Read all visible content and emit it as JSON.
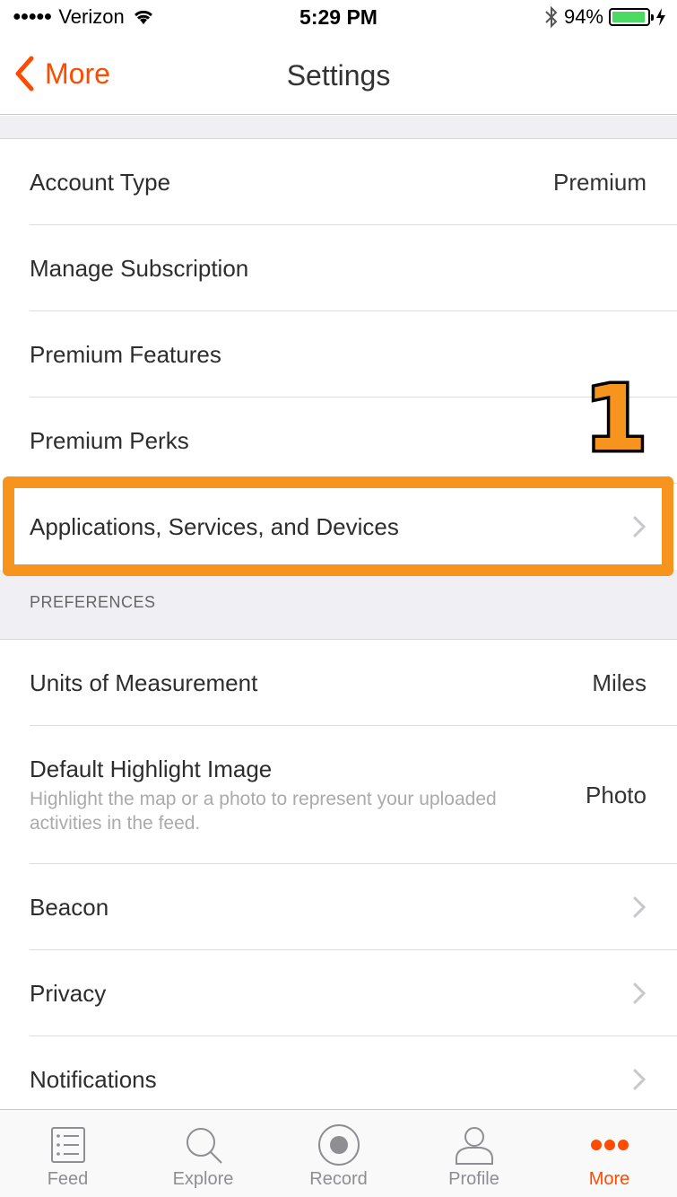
{
  "status_bar": {
    "signal": "●●●●●",
    "carrier": "Verizon",
    "time": "5:29 PM",
    "battery_percent": "94%"
  },
  "nav": {
    "back_label": "More",
    "title": "Settings"
  },
  "account_rows": [
    {
      "label": "Account Type",
      "value": "Premium"
    },
    {
      "label": "Manage Subscription",
      "value": ""
    },
    {
      "label": "Premium Features",
      "value": ""
    },
    {
      "label": "Premium Perks",
      "value": ""
    },
    {
      "label": "Applications, Services, and Devices",
      "value": ""
    }
  ],
  "annotation": {
    "number": "1"
  },
  "preferences": {
    "header": "PREFERENCES",
    "units": {
      "label": "Units of Measurement",
      "value": "Miles"
    },
    "highlight_image": {
      "label": "Default Highlight Image",
      "subtitle": "Highlight the map or a photo to represent your uploaded activities in the feed.",
      "value": "Photo"
    },
    "beacon": {
      "label": "Beacon"
    },
    "privacy": {
      "label": "Privacy"
    },
    "notifications": {
      "label": "Notifications"
    }
  },
  "tabs": [
    {
      "label": "Feed",
      "icon": "feed-icon"
    },
    {
      "label": "Explore",
      "icon": "search-icon"
    },
    {
      "label": "Record",
      "icon": "record-icon"
    },
    {
      "label": "Profile",
      "icon": "profile-icon"
    },
    {
      "label": "More",
      "icon": "more-dots-icon"
    }
  ],
  "colors": {
    "brand": "#fc4c02",
    "annotation": "#f7941d",
    "battery": "#4cd964"
  }
}
